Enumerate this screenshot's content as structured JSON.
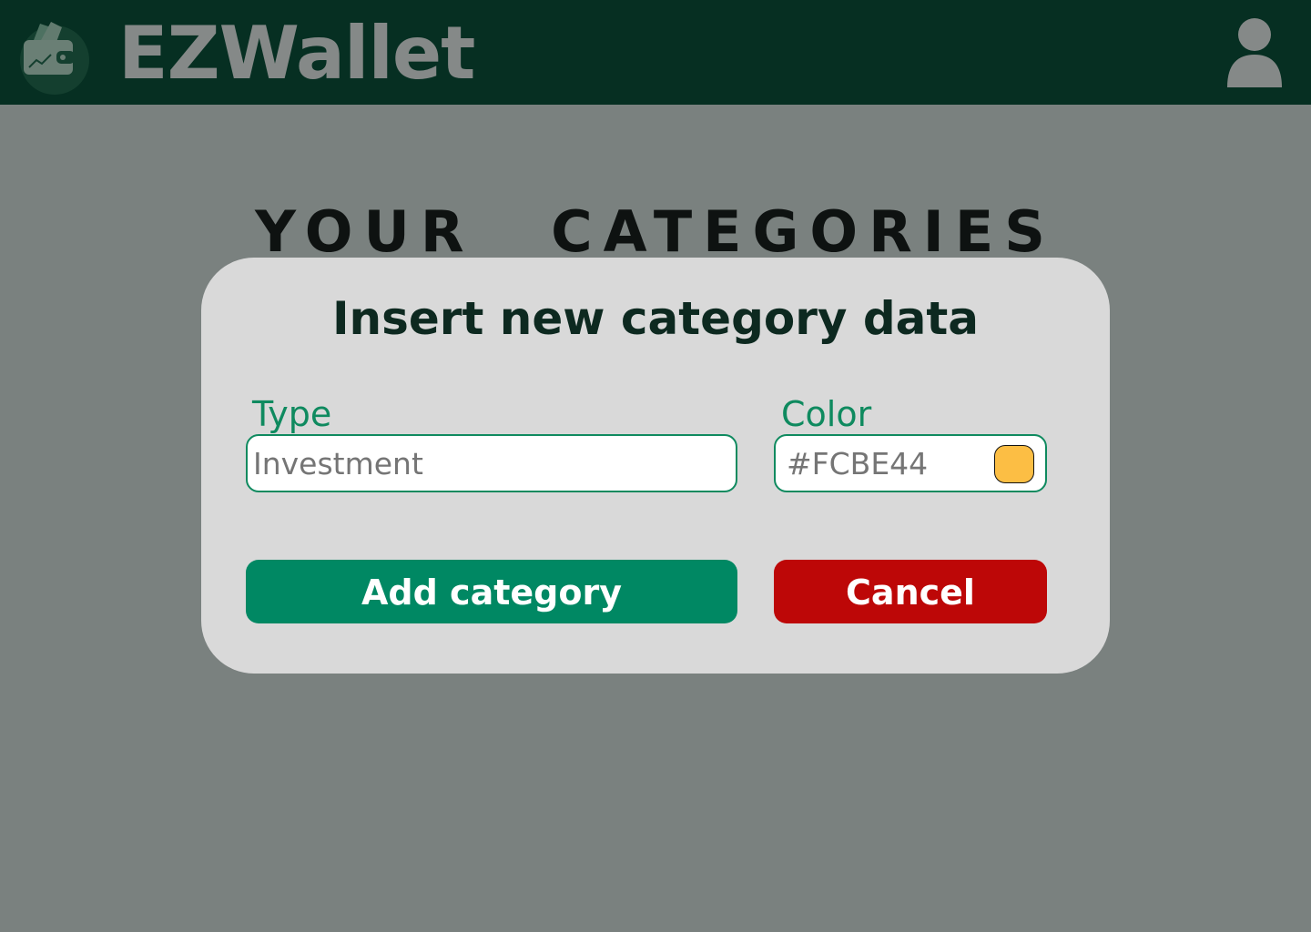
{
  "header": {
    "app_name": "EZWallet",
    "logo_icon": "wallet-icon",
    "user_icon": "user-icon",
    "background_color": "#004b32"
  },
  "main": {
    "page_title": "YOUR CATEGORIES"
  },
  "modal": {
    "title": "Insert new category data",
    "type_field": {
      "label": "Type",
      "placeholder": "Investment",
      "value": ""
    },
    "color_field": {
      "label": "Color",
      "placeholder": "#FCBE44",
      "value": "",
      "swatch_color": "#FCBE44"
    },
    "add_button_label": "Add category",
    "cancel_button_label": "Cancel"
  },
  "colors": {
    "accent_green": "#008863",
    "label_green": "#0f8a5f",
    "cancel_red": "#bd0707",
    "modal_background": "#d9d9d9"
  }
}
